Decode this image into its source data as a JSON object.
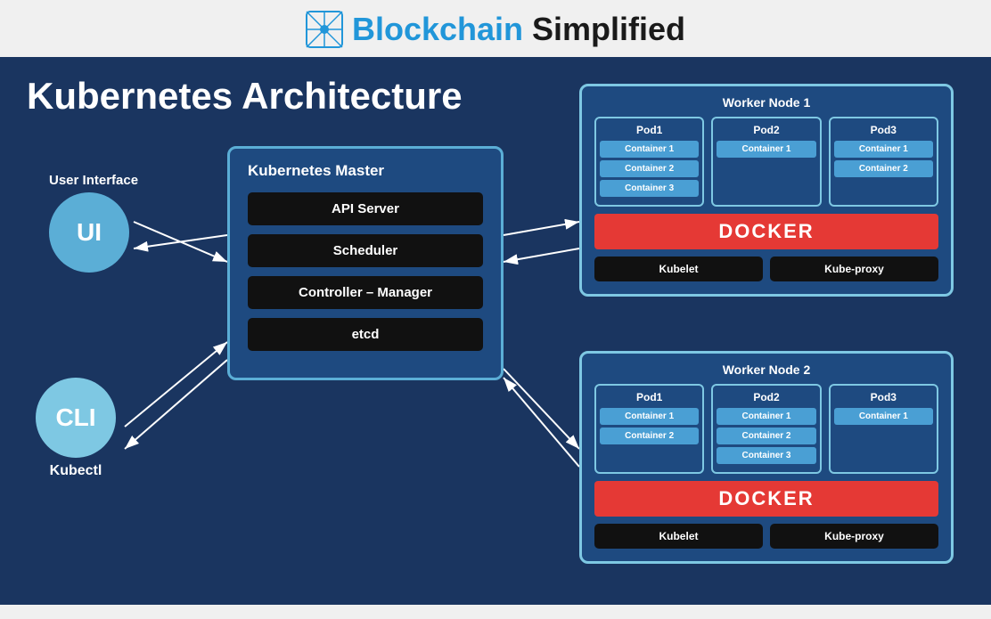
{
  "header": {
    "brand_blue": "Blockchain",
    "brand_dark": "Simplified"
  },
  "main": {
    "title": "Kubernetes Architecture",
    "ui_label": "User Interface",
    "ui_circle": "UI",
    "cli_circle": "CLI",
    "cli_label": "Kubectl",
    "master": {
      "title": "Kubernetes Master",
      "items": [
        "API Server",
        "Scheduler",
        "Controller – Manager",
        "etcd"
      ]
    },
    "worker1": {
      "title": "Worker Node 1",
      "pods": [
        {
          "label": "Pod1",
          "containers": [
            "Container 1",
            "Container 2",
            "Container 3"
          ]
        },
        {
          "label": "Pod2",
          "containers": [
            "Container 1"
          ]
        },
        {
          "label": "Pod3",
          "containers": [
            "Container 1",
            "Container 2"
          ]
        }
      ],
      "docker": "DOCKER",
      "kubelet": "Kubelet",
      "kube_proxy": "Kube-proxy"
    },
    "worker2": {
      "title": "Worker Node 2",
      "pods": [
        {
          "label": "Pod1",
          "containers": [
            "Container 1",
            "Container 2"
          ]
        },
        {
          "label": "Pod2",
          "containers": [
            "Container 1",
            "Container 2",
            "Container 3"
          ]
        },
        {
          "label": "Pod3",
          "containers": [
            "Container 1"
          ]
        }
      ],
      "docker": "DOCKER",
      "kubelet": "Kubelet",
      "kube_proxy": "Kube-proxy"
    }
  }
}
